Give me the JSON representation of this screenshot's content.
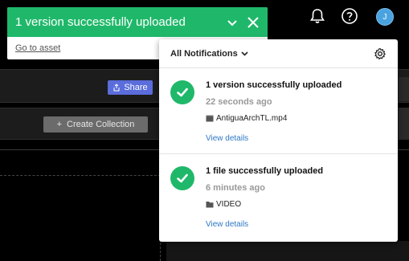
{
  "toast": {
    "title": "1 version successfully uploaded",
    "link": "Go to asset",
    "color": "#1fb86a"
  },
  "header": {
    "avatar_initial": "J"
  },
  "background": {
    "share_label": "Share",
    "create_collection_label": "Create Collection"
  },
  "notifications": {
    "filter_label": "All Notifications",
    "items": [
      {
        "title": "1 version successfully uploaded",
        "time": "22 seconds ago",
        "file": "AntiguaArchTL.mp4",
        "file_icon": "clapper-icon",
        "link": "View details"
      },
      {
        "title": "1 file successfully uploaded",
        "time": "6 minutes ago",
        "file": "VIDEO",
        "file_icon": "folder-icon",
        "link": "View details"
      }
    ]
  }
}
